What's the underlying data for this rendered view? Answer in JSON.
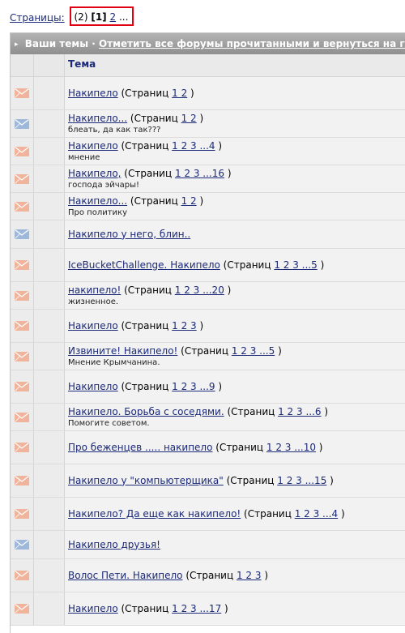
{
  "pager": {
    "label": "Страницы:",
    "count": "(2)",
    "current": "[1]",
    "next": "2",
    "more": "..."
  },
  "header": {
    "arrow": "▸",
    "title": "Ваши темы",
    "sep": "·",
    "mark_all": "Отметить все форумы прочитанными и вернуться на гла"
  },
  "columns": {
    "topic": "Тема"
  },
  "colors": {
    "envelope_new": "#f0b49c",
    "envelope_read": "#9eb8dc"
  },
  "topics": [
    {
      "title": "Накипело",
      "pages_prefix": " (Страниц ",
      "pages": "1 2",
      "pages_suffix": " )",
      "desc": "",
      "icon": "envelope-new",
      "h": 40
    },
    {
      "title": "Накипело...",
      "pages_prefix": " (Страниц ",
      "pages": "1 2",
      "pages_suffix": " )",
      "desc": "блеать, да как так???",
      "icon": "envelope-read",
      "h": 33
    },
    {
      "title": "Накипело",
      "pages_prefix": " (Страниц ",
      "pages": "1 2 3 ...4",
      "pages_suffix": " )",
      "desc": "мнение",
      "icon": "envelope-new",
      "h": 33
    },
    {
      "title": "Накипело,",
      "pages_prefix": " (Страниц ",
      "pages": "1 2 3 ...16",
      "pages_suffix": " )",
      "desc": "господа эйчары!",
      "icon": "envelope-new",
      "h": 33
    },
    {
      "title": "Накипело...",
      "pages_prefix": " (Страниц ",
      "pages": "1 2",
      "pages_suffix": " )",
      "desc": "Про политику",
      "icon": "envelope-new",
      "h": 33
    },
    {
      "title": "Накипело у него, блин..",
      "pages_prefix": "",
      "pages": "",
      "pages_suffix": "",
      "desc": "",
      "icon": "envelope-read",
      "h": 34
    },
    {
      "title": "IceBucketChallenge. Накипело",
      "pages_prefix": " (Страниц ",
      "pages": "1 2 3 ...5",
      "pages_suffix": " )",
      "desc": "",
      "icon": "envelope-new",
      "h": 40
    },
    {
      "title": "накипело!",
      "pages_prefix": " (Страниц ",
      "pages": "1 2 3 ...20",
      "pages_suffix": " )",
      "desc": "жизненное.",
      "icon": "envelope-new",
      "h": 33
    },
    {
      "title": "Накипело",
      "pages_prefix": " (Страниц ",
      "pages": "1 2 3",
      "pages_suffix": " )",
      "desc": "",
      "icon": "envelope-new",
      "h": 40
    },
    {
      "title": "Извините! Накипело!",
      "pages_prefix": " (Страниц ",
      "pages": "1 2 3 ...5",
      "pages_suffix": " )",
      "desc": "Мнение Крымчанина.",
      "icon": "envelope-new",
      "h": 33
    },
    {
      "title": "Накипело",
      "pages_prefix": " (Страниц ",
      "pages": "1 2 3 ...9",
      "pages_suffix": " )",
      "desc": "",
      "icon": "envelope-new",
      "h": 40
    },
    {
      "title": "Накипело. Борьба с соседями.",
      "pages_prefix": " (Страниц ",
      "pages": "1 2 3 ...6",
      "pages_suffix": " )",
      "desc": "Помогите советом.",
      "icon": "envelope-new",
      "h": 33
    },
    {
      "title": "Про беженцев ..... накипело",
      "pages_prefix": " (Страниц ",
      "pages": "1 2 3 ...10",
      "pages_suffix": " )",
      "desc": "",
      "icon": "envelope-new",
      "h": 40
    },
    {
      "title": "Накипело у \"компьютерщика\"",
      "pages_prefix": " (Страниц ",
      "pages": "1 2 3 ...15",
      "pages_suffix": " )",
      "desc": "",
      "icon": "envelope-new",
      "h": 40
    },
    {
      "title": "Накипело? Да еще как накипело!",
      "pages_prefix": " (Страниц ",
      "pages": "1 2 3 ...4",
      "pages_suffix": " )",
      "desc": "",
      "icon": "envelope-new",
      "h": 40
    },
    {
      "title": "Накипело друзья!",
      "pages_prefix": "",
      "pages": "",
      "pages_suffix": "",
      "desc": "",
      "icon": "envelope-read",
      "h": 34
    },
    {
      "title": "Волос Пети. Накипело",
      "pages_prefix": " (Страниц ",
      "pages": "1 2 3",
      "pages_suffix": " )",
      "desc": "",
      "icon": "envelope-new",
      "h": 40
    },
    {
      "title": "Накипело",
      "pages_prefix": " (Страниц ",
      "pages": "1 2 3 ...17",
      "pages_suffix": " )",
      "desc": "",
      "icon": "envelope-new",
      "h": 40
    }
  ]
}
